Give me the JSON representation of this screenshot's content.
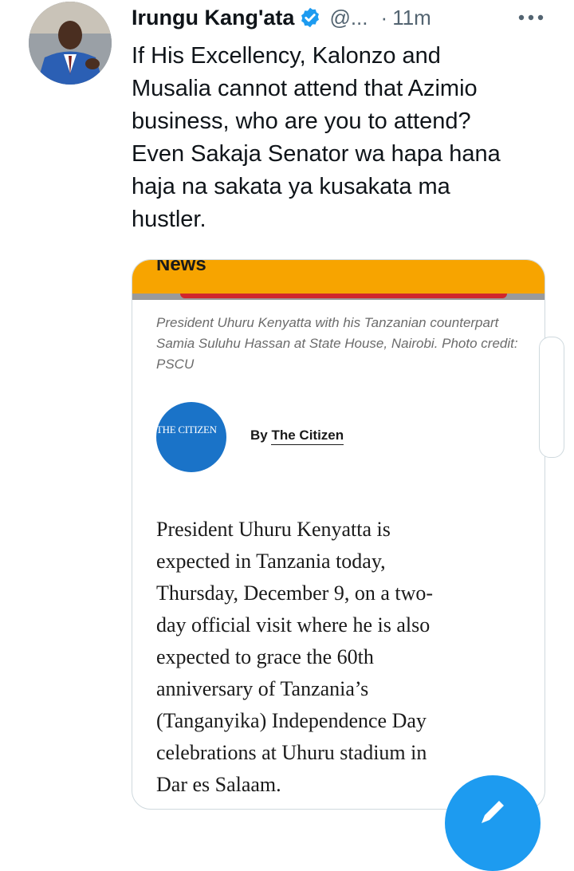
{
  "tweet": {
    "author_name": "Irungu Kang'ata",
    "handle": "@...",
    "separator": "·",
    "time": "11m",
    "text": "If His Excellency,  Kalonzo and\nMusalia cannot attend that Azimio\nbusiness, who are you to attend?\nEven Sakaja Senator wa hapa hana\nhaja na sakata ya kusakata ma\nhustler."
  },
  "card": {
    "banner_label": "News",
    "caption": "President Uhuru Kenyatta with his Tanzanian counterpart Samia Suluhu Hassan at State House, Nairobi. Photo credit: PSCU",
    "logo_text": "THE CITIZEN",
    "byline_prefix": "By",
    "byline_author": "The Citizen",
    "article_text": "President Uhuru Kenyatta is\nexpected in Tanzania today,\nThursday, December 9, on a two-\nday official visit where he is also\nexpected to grace the 60th\nanniversary of Tanzania’s\n(Tanganyika) Independence Day\ncelebrations at Uhuru stadium in\nDar es Salaam."
  },
  "icons": {
    "verified": "verified-badge-icon",
    "more": "more-options-icon",
    "compose": "compose-icon"
  },
  "colors": {
    "accent": "#1d9bf0",
    "banner": "#f7a400",
    "logo_bg": "#1a73c8",
    "secondary_text": "#536471"
  }
}
